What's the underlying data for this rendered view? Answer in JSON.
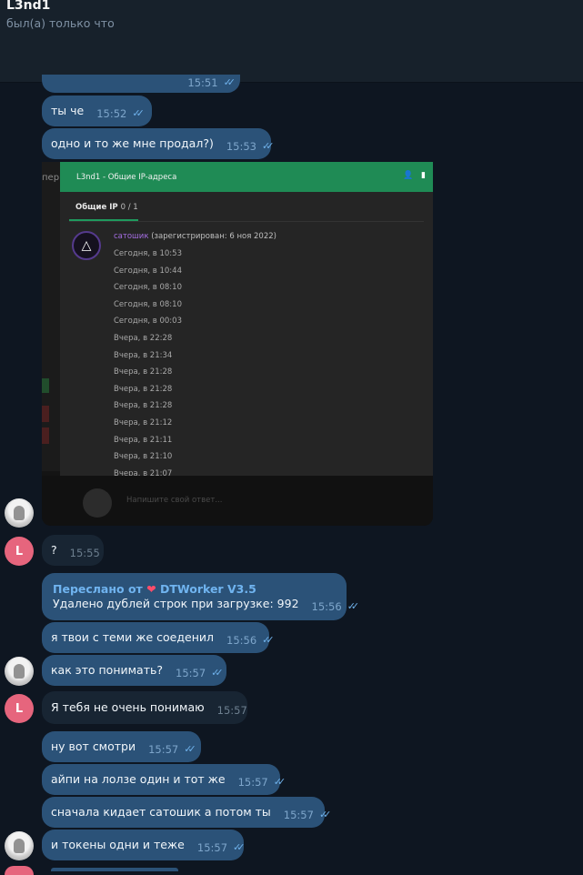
{
  "header": {
    "title": "L3nd1",
    "status": "был(а) только что"
  },
  "messages": [
    {
      "text": "ты че",
      "time": "15:52"
    },
    {
      "text": "одно и то же мне продал?)",
      "time": "15:53"
    },
    {
      "text": "?",
      "time": "15:55"
    },
    {
      "forwarded_prefix": "Переслано от",
      "forwarded_from": "DTWorker V3.5",
      "text": "Удалено дублей строк при загрузке: 992",
      "time": "15:56"
    },
    {
      "text": "я твои с теми же соеденил",
      "time": "15:56"
    },
    {
      "text": "как это понимать?",
      "time": "15:57"
    },
    {
      "text": "Я тебя не очень понимаю",
      "time": "15:57"
    },
    {
      "text": "ну вот смотри",
      "time": "15:57"
    },
    {
      "text": "айпи на лолзе один и тот же",
      "time": "15:57"
    },
    {
      "text": "сначала кидает сатошик а потом ты",
      "time": "15:57"
    },
    {
      "text": "и токены одни и теже",
      "time": "15:57"
    }
  ],
  "partial_top_time": "15:51",
  "avatar_letter": "L",
  "screenshot": {
    "modal_title": "L3nd1 - Общие IP-адреса",
    "tab_label": "Общие IP",
    "tab_count": "0 / 1",
    "user_name": "сатошик",
    "user_reg": "(зарегистрирован: 6 ноя 2022)",
    "entries": [
      "Сегодня, в 10:53",
      "Сегодня, в 10:44",
      "Сегодня, в 08:10",
      "Сегодня, в 08:10",
      "Сегодня, в 00:03",
      "Вчера, в 22:28",
      "Вчера, в 21:34",
      "Вчера, в 21:28",
      "Вчера, в 21:28",
      "Вчера, в 21:28",
      "Вчера, в 21:12",
      "Вчера, в 21:11",
      "Вчера, в 21:10",
      "Вчера, в 21:07"
    ],
    "left_pane_text": "пер",
    "footer_placeholder": "Напишите свой ответ..."
  },
  "colors": {
    "background": "#0e1621",
    "header": "#17212b",
    "outgoing_bubble": "#2b5278",
    "incoming_bubble": "#182533",
    "avatar_l": "#e6657d",
    "modal_green": "#1f8b55"
  }
}
